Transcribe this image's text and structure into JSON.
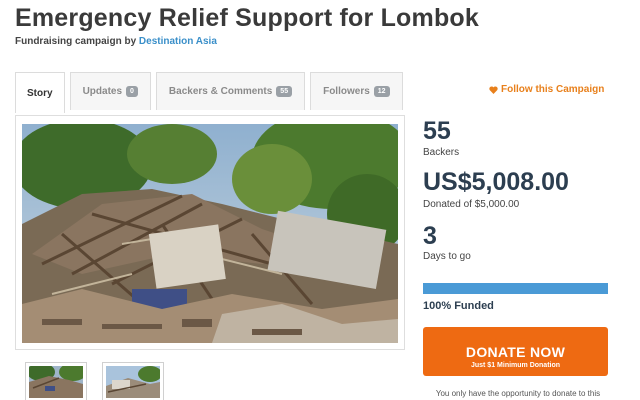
{
  "page": {
    "title": "Emergency Relief Support for Lombok",
    "subtitle_prefix": "Fundraising campaign by",
    "organizer": "Destination Asia"
  },
  "tabs": [
    {
      "label": "Story",
      "count": null,
      "active": true
    },
    {
      "label": "Updates",
      "count": "0"
    },
    {
      "label": "Backers & Comments",
      "count": "55"
    },
    {
      "label": "Followers",
      "count": "12"
    }
  ],
  "follow": {
    "label": "Follow this Campaign",
    "icon": "heart-icon"
  },
  "media": {
    "main_image": "collapsed-house-rubble-photo",
    "thumbnails": [
      "rubble-thumbnail-1",
      "damaged-building-thumbnail-2"
    ]
  },
  "stats": {
    "backers_count": "55",
    "backers_label": "Backers",
    "amount": "US$5,008.00",
    "amount_label": "Donated of $5,000.00",
    "days": "3",
    "days_label": "Days to go",
    "progress_fraction": 1.0,
    "funded_label": "100% Funded"
  },
  "donate": {
    "label": "DONATE NOW",
    "sublabel": "Just $1 Minimum Donation",
    "note": "You only have the opportunity to donate to this"
  },
  "colors": {
    "accent_orange": "#ee6a12",
    "follow_orange": "#e8801c",
    "link_blue": "#3a8fc9",
    "progress_blue": "#4a9ad6",
    "stat_navy": "#2c3e50"
  }
}
